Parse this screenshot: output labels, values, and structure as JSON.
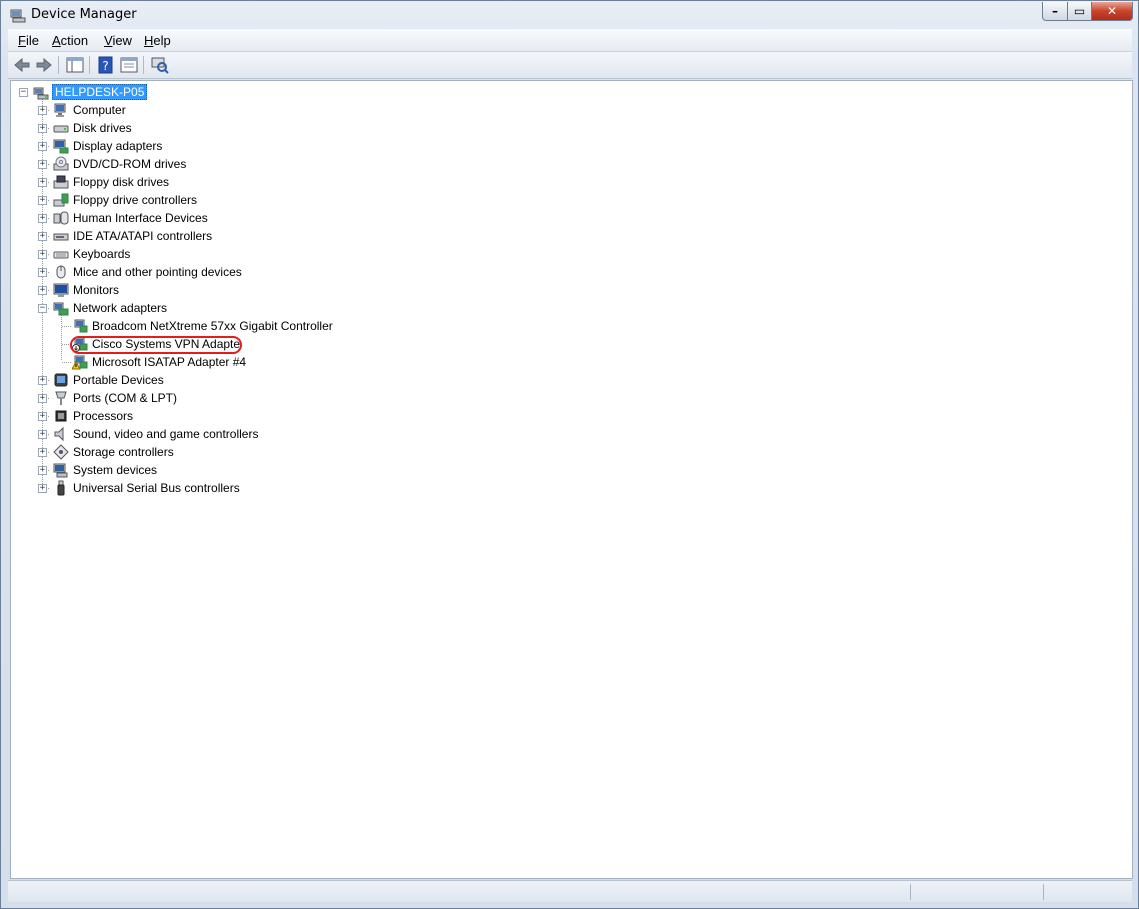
{
  "window": {
    "title": "Device Manager"
  },
  "menu": [
    {
      "label": "File",
      "key": "F",
      "rest": "ile"
    },
    {
      "label": "Action",
      "key": "A",
      "rest": "ction"
    },
    {
      "label": "View",
      "key": "V",
      "rest": "iew"
    },
    {
      "label": "Help",
      "key": "H",
      "rest": "elp"
    }
  ],
  "toolbar": [
    "back-icon",
    "forward-icon",
    "show-hide-console-tree-icon",
    "help-icon",
    "properties-icon",
    "scan-hardware-icon"
  ],
  "tree": {
    "root": "HELPDESK-P05",
    "categories": [
      {
        "label": "Computer",
        "icon": "computer-icon"
      },
      {
        "label": "Disk drives",
        "icon": "disk-drive-icon"
      },
      {
        "label": "Display adapters",
        "icon": "display-adapter-icon"
      },
      {
        "label": "DVD/CD-ROM drives",
        "icon": "dvd-icon"
      },
      {
        "label": "Floppy disk drives",
        "icon": "floppy-icon"
      },
      {
        "label": "Floppy drive controllers",
        "icon": "floppy-controller-icon"
      },
      {
        "label": "Human Interface Devices",
        "icon": "hid-icon"
      },
      {
        "label": "IDE ATA/ATAPI controllers",
        "icon": "ide-icon"
      },
      {
        "label": "Keyboards",
        "icon": "keyboard-icon"
      },
      {
        "label": "Mice and other pointing devices",
        "icon": "mouse-icon"
      },
      {
        "label": "Monitors",
        "icon": "monitor-icon"
      },
      {
        "label": "Network adapters",
        "icon": "network-adapter-icon",
        "expanded": true
      },
      {
        "label": "Portable Devices",
        "icon": "portable-device-icon"
      },
      {
        "label": "Ports (COM & LPT)",
        "icon": "port-icon"
      },
      {
        "label": "Processors",
        "icon": "processor-icon"
      },
      {
        "label": "Sound, video and game controllers",
        "icon": "sound-icon"
      },
      {
        "label": "Storage controllers",
        "icon": "storage-icon"
      },
      {
        "label": "System devices",
        "icon": "system-device-icon"
      },
      {
        "label": "Universal Serial Bus controllers",
        "icon": "usb-icon"
      }
    ],
    "network_children": [
      {
        "label": "Broadcom NetXtreme 57xx Gigabit Controller",
        "status": "ok"
      },
      {
        "label": "Cisco Systems VPN Adapte",
        "status": "disabled",
        "highlighted": true
      },
      {
        "label": "Microsoft ISATAP Adapter #4",
        "status": "warning"
      }
    ]
  },
  "colors": {
    "selection": "#3399ff",
    "highlight_ring": "#e21d1d",
    "warning": "#f5c400"
  }
}
